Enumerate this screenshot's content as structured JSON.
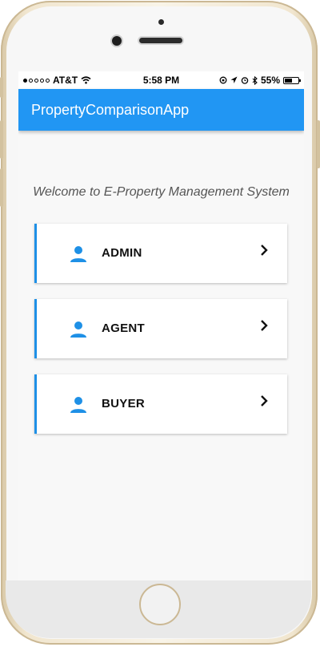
{
  "status_bar": {
    "carrier": "AT&T",
    "time": "5:58 PM",
    "battery_percent": "55%",
    "battery_level": 0.55
  },
  "app_bar": {
    "title": "PropertyComparisonApp",
    "color": "#2196f3"
  },
  "main": {
    "welcome_text": "Welcome to E-Property Management System",
    "roles": [
      {
        "label": "ADMIN",
        "icon": "person-icon"
      },
      {
        "label": "AGENT",
        "icon": "person-icon"
      },
      {
        "label": "BUYER",
        "icon": "person-icon"
      }
    ],
    "accent_color": "#1e90e6"
  }
}
